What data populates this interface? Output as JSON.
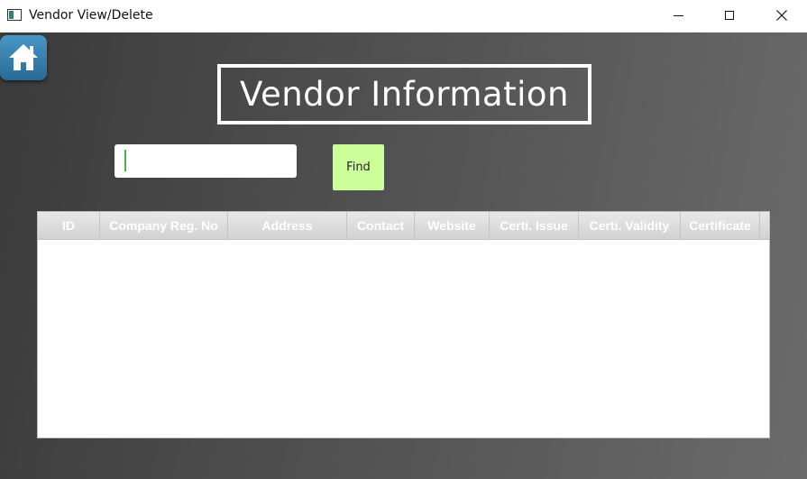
{
  "window": {
    "title": "Vendor View/Delete"
  },
  "page": {
    "heading": "Vendor Information"
  },
  "search": {
    "value": "",
    "placeholder": ""
  },
  "find_button": {
    "label": "Find"
  },
  "table": {
    "columns": [
      "ID",
      "Company Reg. No",
      "Address",
      "Contact",
      "Website",
      "Certi. Issue",
      "Certi. Validity",
      "Certificate"
    ],
    "rows": []
  },
  "colors": {
    "find_button": "#ccff99",
    "home_button": "#3a82b2",
    "caret": "#4caf50"
  },
  "icons": {
    "home": "home-icon",
    "minimize": "minimize-icon",
    "maximize": "maximize-icon",
    "close": "close-icon"
  }
}
